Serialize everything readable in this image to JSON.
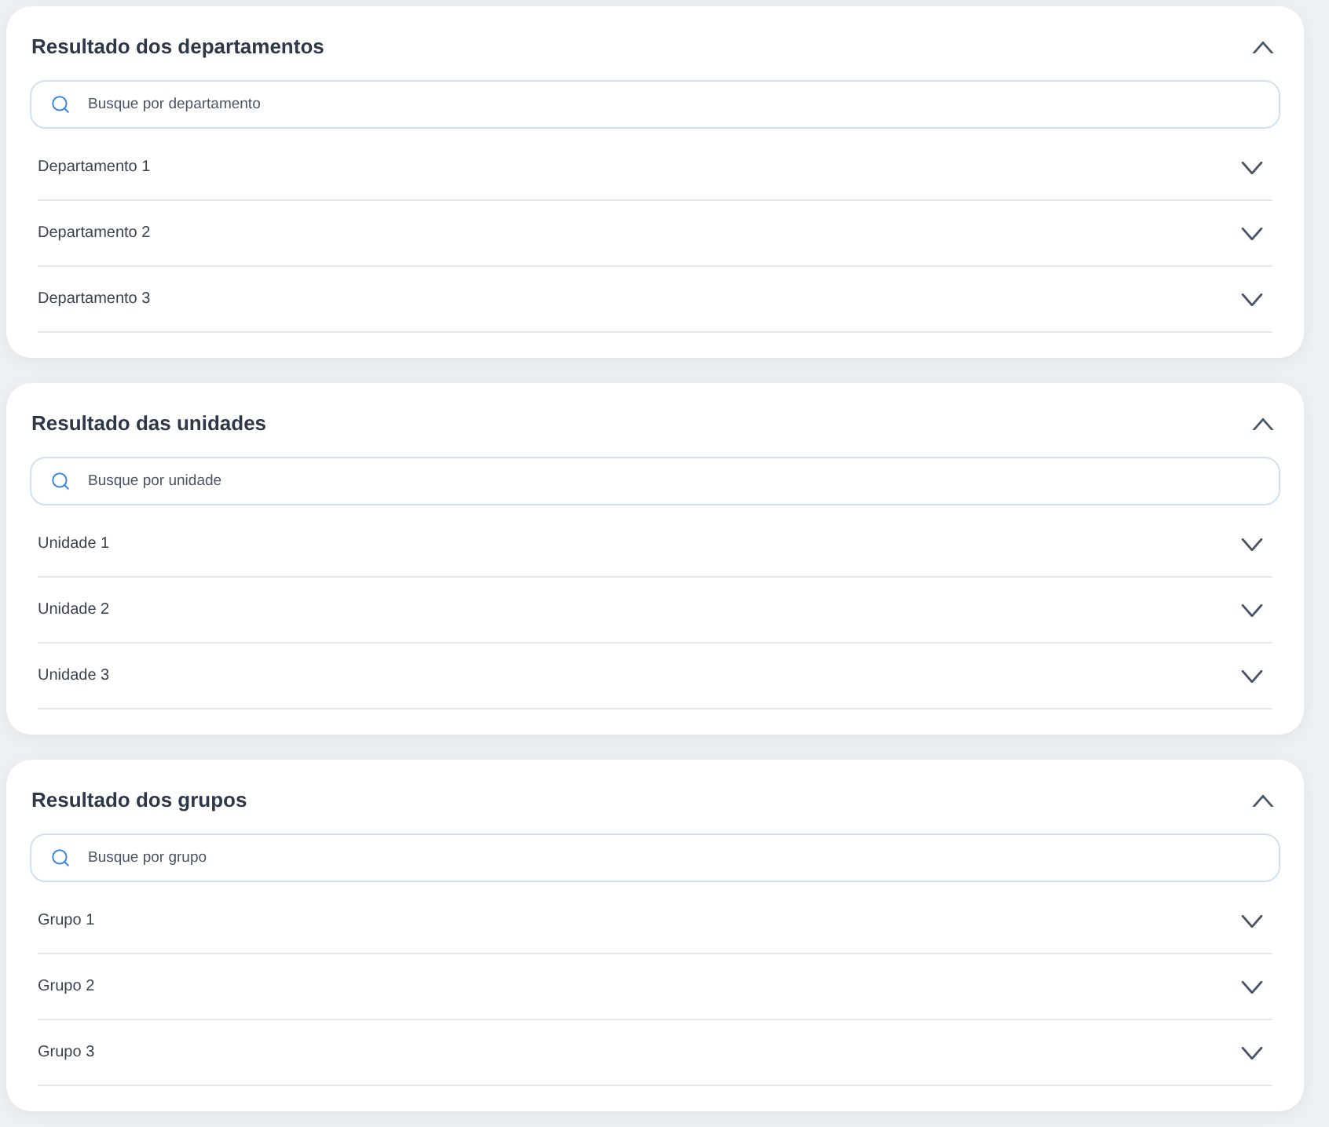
{
  "sections": [
    {
      "title": "Resultado dos departamentos",
      "expanded": true,
      "search": {
        "placeholder": "Busque por departamento"
      },
      "items": [
        {
          "label": "Departamento 1",
          "expanded": false
        },
        {
          "label": "Departamento 2",
          "expanded": false
        },
        {
          "label": "Departamento 3",
          "expanded": false
        }
      ]
    },
    {
      "title": "Resultado das unidades",
      "expanded": true,
      "search": {
        "placeholder": "Busque por unidade"
      },
      "items": [
        {
          "label": "Unidade 1",
          "expanded": false
        },
        {
          "label": "Unidade 2",
          "expanded": false
        },
        {
          "label": "Unidade 3",
          "expanded": false
        }
      ]
    },
    {
      "title": "Resultado dos grupos",
      "expanded": true,
      "search": {
        "placeholder": "Busque por grupo"
      },
      "items": [
        {
          "label": "Grupo 1",
          "expanded": false
        },
        {
          "label": "Grupo 2",
          "expanded": false
        },
        {
          "label": "Grupo 3",
          "expanded": false
        }
      ]
    }
  ]
}
